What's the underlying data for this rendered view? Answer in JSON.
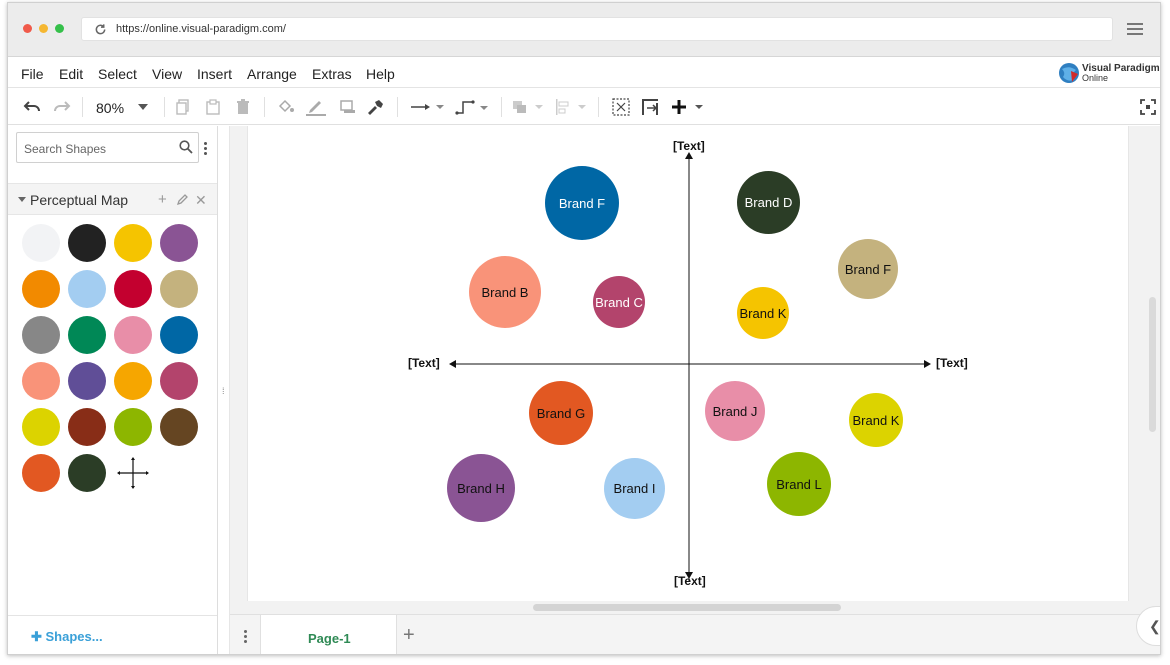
{
  "browser": {
    "url": "https://online.visual-paradigm.com/"
  },
  "menubar": {
    "items": [
      "File",
      "Edit",
      "Select",
      "View",
      "Insert",
      "Arrange",
      "Extras",
      "Help"
    ],
    "logo_line1": "Visual Paradigm",
    "logo_line2": "Online"
  },
  "toolbar": {
    "zoom": "80%"
  },
  "sidebar": {
    "search_placeholder": "Search Shapes",
    "section_title": "Perceptual Map",
    "palette_colors": [
      "#f2f3f5",
      "#222222",
      "#f5c400",
      "#8a5494",
      "#f28a00",
      "#a3cdf1",
      "#c3002f",
      "#c4b27e",
      "#878787",
      "#008856",
      "#e88ea8",
      "#0067a5",
      "#f99379",
      "#604e97",
      "#f6a600",
      "#b3446c",
      "#dcd300",
      "#882d17",
      "#8db600",
      "#654522",
      "#e25822",
      "#2b3d26"
    ],
    "shapes_link": "Shapes..."
  },
  "diagram": {
    "axis_labels": {
      "top": "[Text]",
      "bottom": "[Text]",
      "left": "[Text]",
      "right": "[Text]"
    },
    "brands": [
      {
        "label": "Brand F",
        "color": "#0067a5",
        "text_color": "#ffffff"
      },
      {
        "label": "Brand D",
        "color": "#2b3d26",
        "text_color": "#ffffff"
      },
      {
        "label": "Brand F",
        "color": "#c4b27e",
        "text_color": "#111111"
      },
      {
        "label": "Brand B",
        "color": "#f99379",
        "text_color": "#111111"
      },
      {
        "label": "Brand C",
        "color": "#b3446c",
        "text_color": "#ffffff"
      },
      {
        "label": "Brand K",
        "color": "#f5c400",
        "text_color": "#111111"
      },
      {
        "label": "Brand G",
        "color": "#e25822",
        "text_color": "#111111"
      },
      {
        "label": "Brand J",
        "color": "#e88ea8",
        "text_color": "#111111"
      },
      {
        "label": "Brand K",
        "color": "#dcd300",
        "text_color": "#111111"
      },
      {
        "label": "Brand H",
        "color": "#8a5494",
        "text_color": "#111111"
      },
      {
        "label": "Brand I",
        "color": "#a3cdf1",
        "text_color": "#111111"
      },
      {
        "label": "Brand L",
        "color": "#8db600",
        "text_color": "#111111"
      }
    ]
  },
  "pages": {
    "tabs": [
      "Page-1"
    ]
  }
}
